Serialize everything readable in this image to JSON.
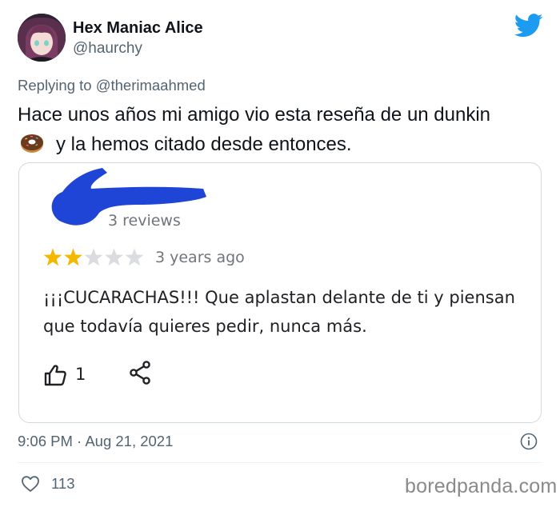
{
  "author": {
    "name": "Hex Maniac Alice",
    "handle": "@haurchy"
  },
  "reply": {
    "prefix": "Replying to",
    "mention": "@therimaahmed"
  },
  "tweet": {
    "line1": "Hace unos años mi amigo vio esta reseña de un dunkin",
    "line2": "y la hemos citado desde entonces."
  },
  "review_card": {
    "reviews_count": "3 reviews",
    "rating": 2,
    "rating_max": 5,
    "age": "3 years ago",
    "text": "¡¡¡CUCARACHAS!!! Que aplastan delante de ti y piensan que todavía quieres pedir, nunca más.",
    "likes": "1"
  },
  "meta": {
    "timestamp": "9:06 PM · Aug 21, 2021",
    "like_total": "113"
  },
  "watermark": "boredpanda.com",
  "colors": {
    "twitter_blue": "#1d9bf0",
    "censor_blue": "#1f45d6",
    "star_gold": "#f5b800",
    "star_grey": "#dadce0",
    "secondary_text": "#536471"
  },
  "icons": [
    "avatar",
    "twitter-bird-icon",
    "donut-emoji-icon",
    "thumbs-up-icon",
    "share-icon",
    "info-icon",
    "heart-icon"
  ]
}
